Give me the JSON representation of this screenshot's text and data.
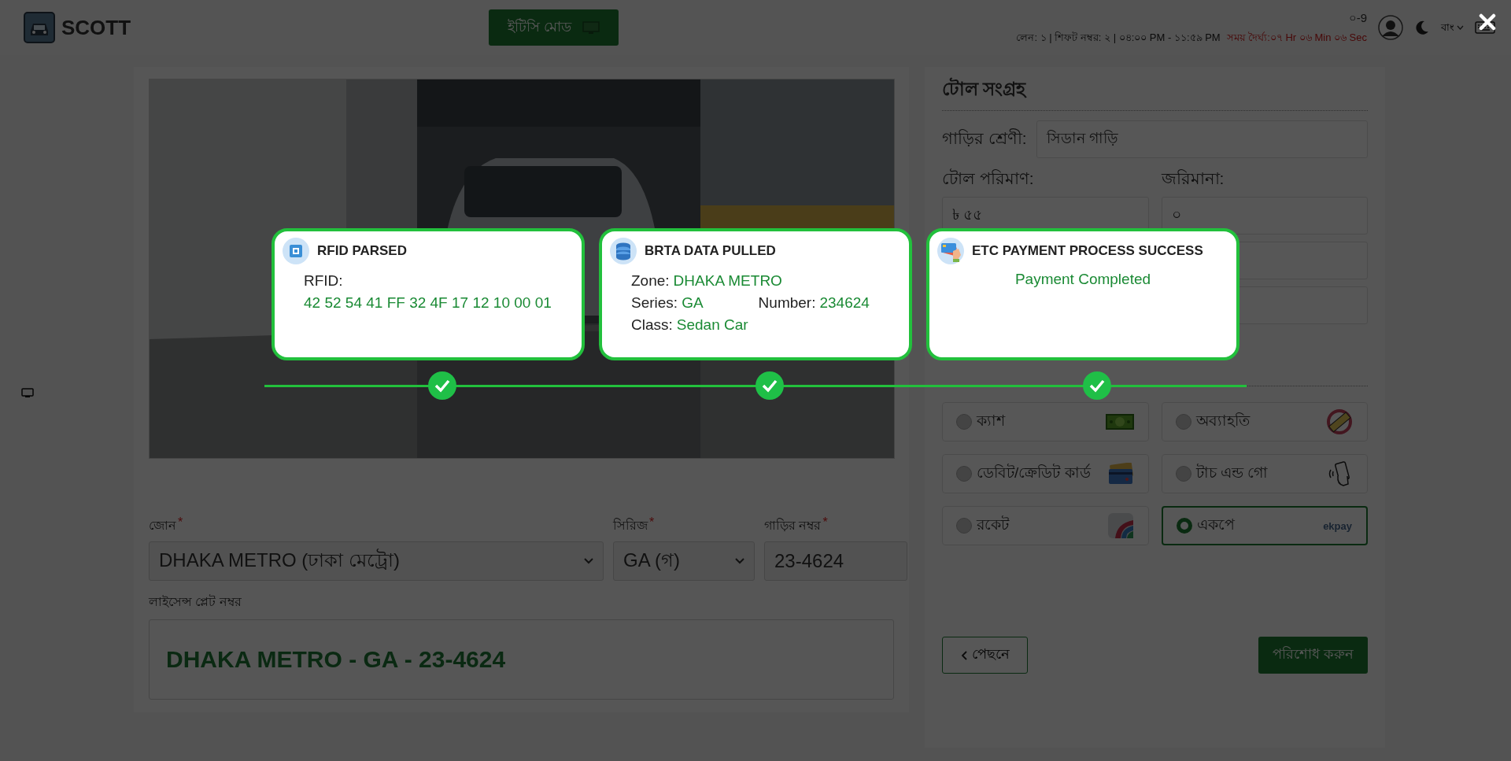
{
  "header": {
    "brand": "SCOTT",
    "mode_button": "ইটিসি মোড",
    "counter": "০-9",
    "shift_info": "লেন: ১ | শিফট নম্বর: ২ | ০৪:০০ PM - ১১:৫৯ PM",
    "duration": "সময় দৈর্ঘ্য:০৭ Hr ০৬ Min ০৬ Sec",
    "language": "বাং"
  },
  "vehicle_form": {
    "fields": [
      {
        "label": "জোন",
        "required_mark": "*",
        "value": "DHAKA METRO (ঢাকা মেট্রো)",
        "kind": "select"
      },
      {
        "label": "সিরিজ",
        "required_mark": "*",
        "value": "GA (গ)",
        "kind": "select"
      },
      {
        "label": "গাড়ির নম্বর",
        "required_mark": "*",
        "value": "23-4624",
        "kind": "input"
      }
    ],
    "plate": {
      "label": "লাইসেন্স প্লেট নম্বর",
      "value": "DHAKA METRO - GA - 23-4624"
    }
  },
  "toll": {
    "title": "টোল সংগ্রহ",
    "vehicle_class": {
      "label": "গাড়ির শ্রেণী:",
      "value": "সিডান গাড়ি"
    },
    "amounts": [
      {
        "label": "টোল পরিমাণ:",
        "value": "৳ ৫৫"
      },
      {
        "label": "জরিমানা:",
        "value": "০"
      }
    ],
    "payment_methods": [
      {
        "label": "ক্যাশ",
        "kind": "cash",
        "selected": false
      },
      {
        "label": "অব্যাহতি",
        "kind": "exempt",
        "selected": false
      },
      {
        "label": "ডেবিট/ক্রেডিট কার্ড",
        "kind": "card",
        "selected": false
      },
      {
        "label": "টাচ এন্ড গো",
        "kind": "tap",
        "selected": false
      },
      {
        "label": "রকেট",
        "kind": "rocket",
        "selected": false
      },
      {
        "label": "একপে",
        "kind": "ekpay",
        "logo_text": "ekpay",
        "selected": true
      }
    ],
    "back_button": "পেছনে",
    "pay_button": "পরিশোধ করুন"
  },
  "steps": [
    {
      "kind": "rfid",
      "title": "RFID PARSED",
      "done": true,
      "rows": [
        [
          {
            "label": "RFID:"
          }
        ],
        [
          {
            "value": "42 52 54 41 FF 32 4F 17 12 10 00 01"
          }
        ]
      ]
    },
    {
      "kind": "brta",
      "title": "BRTA DATA PULLED",
      "done": true,
      "rows": [
        [
          {
            "label": "Zone:",
            "value": "DHAKA METRO"
          }
        ],
        [
          {
            "label": "Series:",
            "value": "GA"
          },
          {
            "label": "Number:",
            "value": "234624"
          }
        ],
        [
          {
            "label": "Class:",
            "value": "Sedan Car"
          }
        ]
      ]
    },
    {
      "kind": "payment",
      "title": "ETC PAYMENT PROCESS SUCCESS",
      "done": true,
      "rows": [
        [
          {
            "value": "Payment Completed"
          }
        ]
      ]
    }
  ]
}
